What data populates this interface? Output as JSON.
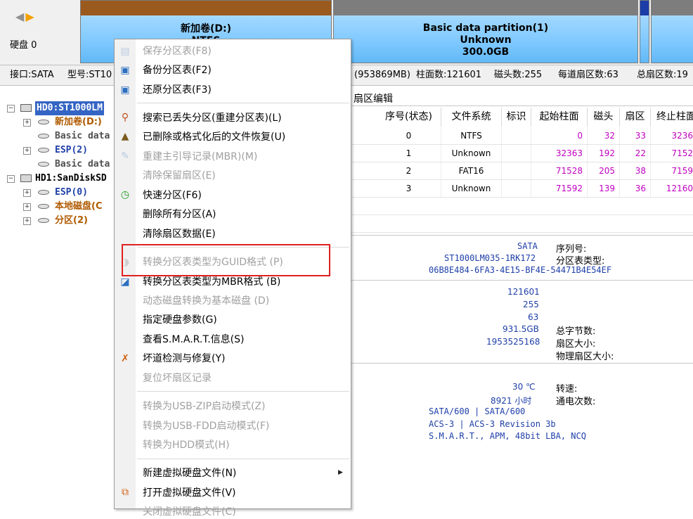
{
  "topbar": {
    "disk_label": "硬盘 0",
    "partitions": [
      {
        "line1": "新加卷(D:)",
        "line2": "NTFS"
      },
      {
        "line1": "Basic data partition(1)",
        "line2": "Unknown",
        "line3": "300.0GB"
      }
    ]
  },
  "info_bar": {
    "interface": "接口:SATA",
    "model": "型号:ST10",
    "capacity_mb": "(953869MB)",
    "cylinders": "柱面数:121601",
    "heads": "磁头数:255",
    "sectors_per_track": "每道扇区数:63",
    "total_sectors": "总扇区数:19"
  },
  "tree": {
    "items": [
      {
        "label": "HD0:ST1000LM",
        "type": "disk"
      },
      {
        "label": "新加卷(D:)",
        "type": "partition"
      },
      {
        "label": "Basic data",
        "type": "partition-plain"
      },
      {
        "label": "ESP(2)",
        "type": "partition"
      },
      {
        "label": "Basic data",
        "type": "partition-plain"
      },
      {
        "label": "HD1:SanDiskSD",
        "type": "disk"
      },
      {
        "label": "ESP(0)",
        "type": "partition"
      },
      {
        "label": "本地磁盘(C",
        "type": "partition"
      },
      {
        "label": "分区(2)",
        "type": "partition"
      }
    ]
  },
  "right_panel": {
    "tab": "扇区编辑",
    "columns": [
      "序号(状态)",
      "文件系统",
      "标识",
      "起始柱面",
      "磁头",
      "扇区",
      "终止柱面"
    ],
    "rows": [
      {
        "index": "0",
        "fs": "NTFS",
        "flag": "",
        "start_cyl": "0",
        "head": "32",
        "sector": "33",
        "end_cyl": "3236"
      },
      {
        "index": "1",
        "fs": "Unknown",
        "flag": "",
        "start_cyl": "32363",
        "head": "192",
        "sector": "22",
        "end_cyl": "7152"
      },
      {
        "index": "2",
        "fs": "FAT16",
        "flag": "",
        "start_cyl": "71528",
        "head": "205",
        "sector": "38",
        "end_cyl": "7159"
      },
      {
        "index": "3",
        "fs": "Unknown",
        "flag": "",
        "start_cyl": "71592",
        "head": "139",
        "sector": "36",
        "end_cyl": "12160"
      }
    ]
  },
  "disk_info": {
    "interface": "SATA",
    "model": "ST1000LM035-1RK172",
    "guid": "06B8E484-6FA3-4E15-BF4E-54471B4E54EF",
    "serial_label": "序列号:",
    "table_type_label": "分区表类型:",
    "cylinders": "121601",
    "heads": "255",
    "sectors": "63",
    "capacity": "931.5GB",
    "total_sectors": "1953525168",
    "total_bytes_label": "总字节数:",
    "sector_size_label": "扇区大小:",
    "physical_sector_label": "物理扇区大小:",
    "temperature": "30 ℃",
    "power_on_hours": "8921 小时",
    "rpm_label": "转速:",
    "power_on_count_label": "通电次数:",
    "sata": "SATA/600 | SATA/600",
    "acs": "ACS-3 | ACS-3 Revision 3b",
    "features": "S.M.A.R.T., APM, 48bit LBA, NCQ"
  },
  "context_menu": {
    "items": [
      {
        "label": "保存分区表(F8)",
        "disabled": true,
        "icon": "save-icon"
      },
      {
        "label": "备份分区表(F2)",
        "disabled": false,
        "icon": "backup-icon"
      },
      {
        "label": "还原分区表(F3)",
        "disabled": false,
        "icon": "restore-icon"
      },
      {
        "label": "搜索已丢失分区(重建分区表)(L)",
        "disabled": false,
        "icon": "search-icon"
      },
      {
        "label": "已删除或格式化后的文件恢复(U)",
        "disabled": false,
        "icon": "recover-icon"
      },
      {
        "label": "重建主引导记录(MBR)(M)",
        "disabled": true,
        "icon": "mbr-icon"
      },
      {
        "label": "清除保留扇区(E)",
        "disabled": true
      },
      {
        "label": "快速分区(F6)",
        "disabled": false,
        "icon": "clock-icon"
      },
      {
        "label": "删除所有分区(A)",
        "disabled": false
      },
      {
        "label": "清除扇区数据(E)",
        "disabled": false
      },
      {
        "label": "转换分区表类型为GUID格式 (P)",
        "disabled": true,
        "icon": "convert-icon"
      },
      {
        "label": "转换分区表类型为MBR格式 (B)",
        "disabled": false,
        "icon": "convert-icon"
      },
      {
        "label": "动态磁盘转换为基本磁盘 (D)",
        "disabled": true
      },
      {
        "label": "指定硬盘参数(G)",
        "disabled": false
      },
      {
        "label": "查看S.M.A.R.T.信息(S)",
        "disabled": false
      },
      {
        "label": "坏道检测与修复(Y)",
        "disabled": false,
        "icon": "tools-icon"
      },
      {
        "label": "复位坏扇区记录",
        "disabled": true
      },
      {
        "label": "转换为USB-ZIP启动模式(Z)",
        "disabled": true
      },
      {
        "label": "转换为USB-FDD启动模式(F)",
        "disabled": true
      },
      {
        "label": "转换为HDD模式(H)",
        "disabled": true
      },
      {
        "label": "新建虚拟硬盘文件(N)",
        "disabled": false,
        "submenu": true
      },
      {
        "label": "打开虚拟硬盘文件(V)",
        "disabled": false,
        "icon": "open-vdisk-icon"
      },
      {
        "label": "关闭虚拟硬盘文件(C)",
        "disabled": true
      }
    ]
  },
  "colors": {
    "accent_highlight": "#e02020",
    "disabled_text": "#a0a0a0",
    "partition_fill": "#7ec8ff",
    "tree_orange": "#b05a00",
    "tree_blue": "#1e3fa8",
    "magenta_values": "#c000c0"
  }
}
